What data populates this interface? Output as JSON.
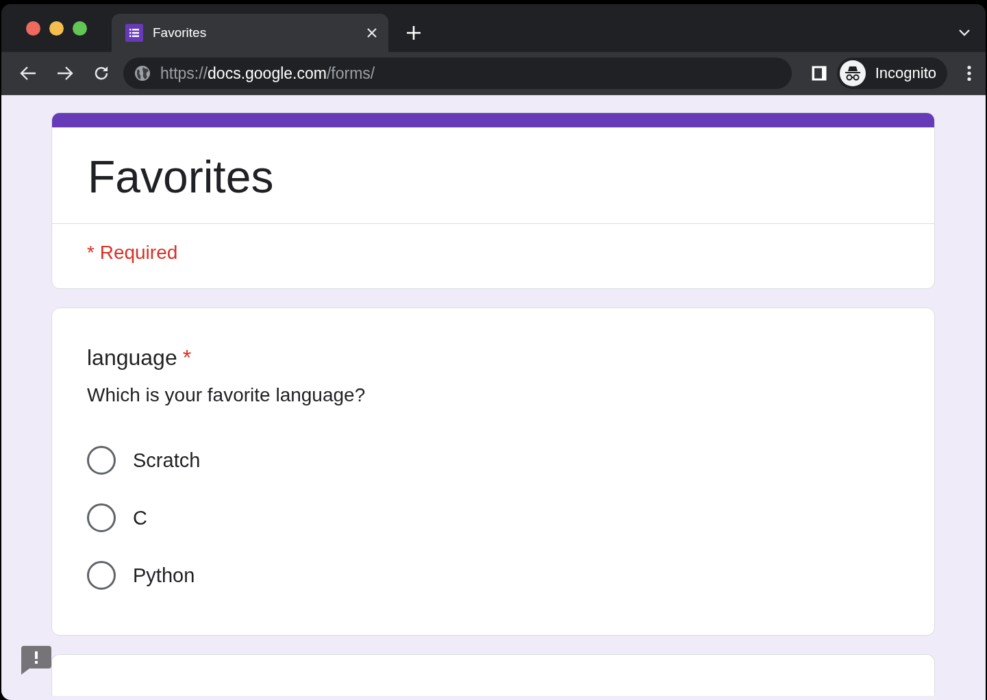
{
  "browser": {
    "tab": {
      "title": "Favorites",
      "selected": true
    },
    "url": {
      "scheme": "https://",
      "host": "docs.google.com",
      "path": "/forms/"
    },
    "profile": {
      "label": "Incognito"
    }
  },
  "form": {
    "title": "Favorites",
    "required_note": "* Required"
  },
  "question": {
    "title": "language",
    "required_mark": "*",
    "description": "Which is your favorite language?",
    "options": [
      {
        "label": "Scratch",
        "selected": false
      },
      {
        "label": "C",
        "selected": false
      },
      {
        "label": "Python",
        "selected": false
      }
    ]
  }
}
